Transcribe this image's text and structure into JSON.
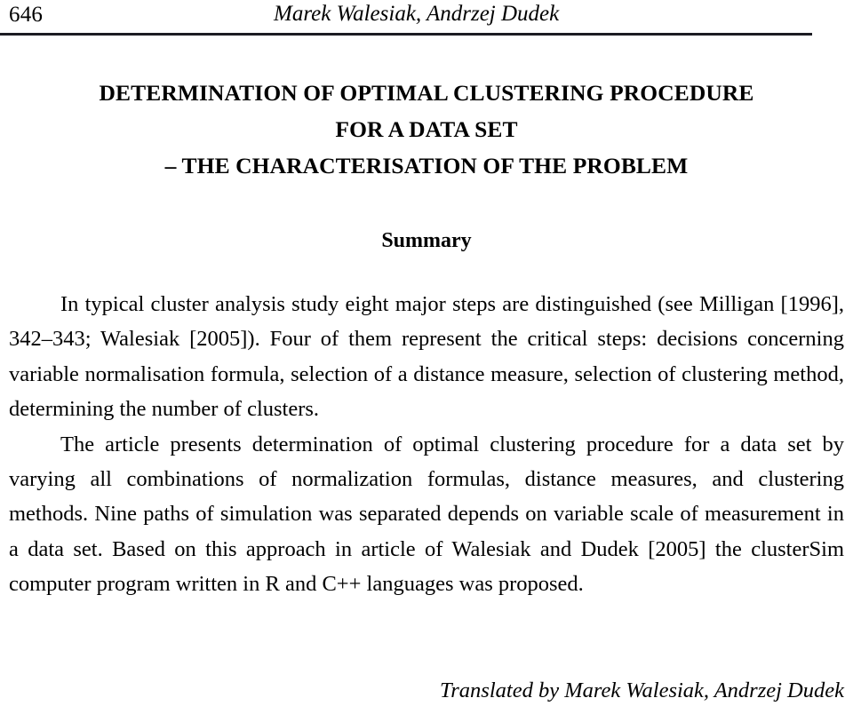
{
  "header": {
    "page_number": "646",
    "authors": "Marek Walesiak, Andrzej Dudek"
  },
  "title": {
    "line1": "DETERMINATION OF OPTIMAL CLUSTERING PROCEDURE",
    "line2": "FOR A DATA SET",
    "line3": "– THE CHARACTERISATION OF THE PROBLEM"
  },
  "section": {
    "summary_heading": "Summary"
  },
  "abstract": {
    "paragraph1": "In typical cluster analysis study eight major steps are distinguished (see Milligan [1996], 342–343; Walesiak [2005]). Four of them represent the critical steps: decisions concerning variable normalisation formula, selection of a distance measure, selection of clustering method, determining the number of clusters.",
    "paragraph2": "The article presents determination of optimal clustering procedure for a data set by varying all combinations of normalization formulas, distance measures, and clustering methods. Nine paths of simulation was separated depends on variable scale of measurement in a data set. Based on this approach in article of Walesiak and Dudek [2005] the clusterSim computer program written in R and C++ languages was proposed."
  },
  "footer": {
    "translator_credit": "Translated by Marek Walesiak, Andrzej Dudek"
  },
  "colors": {
    "text": "#000000",
    "rule": "#1b1b22",
    "background": "#ffffff"
  }
}
